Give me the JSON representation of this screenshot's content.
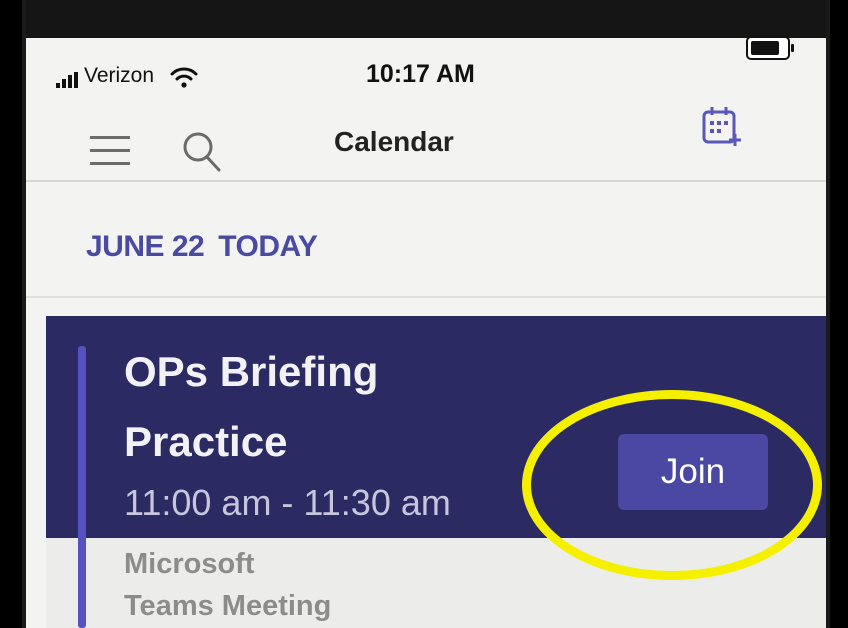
{
  "status_bar": {
    "carrier": "Verizon",
    "time": "10:17 AM"
  },
  "header": {
    "title": "Calendar"
  },
  "date_header": {
    "date": "JUNE 22",
    "today": "TODAY"
  },
  "meeting": {
    "title_line1": "OPs Briefing",
    "title_line2": "Practice",
    "time_range": "11:00 am - 11:30 am",
    "location_line1": "Microsoft",
    "location_line2": "Teams Meeting",
    "join_label": "Join"
  },
  "colors": {
    "accent": "#4b4aa3",
    "card_background": "#2b2a63",
    "join_button": "#4b48a4",
    "highlight": "#f4f000"
  },
  "icons": [
    "menu-icon",
    "search-icon",
    "calendar-add-icon",
    "wifi-icon",
    "signal-icon",
    "battery-icon"
  ]
}
